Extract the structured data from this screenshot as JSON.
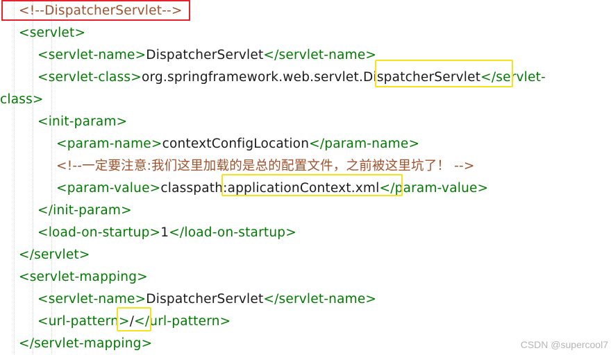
{
  "lines": [
    {
      "indent": 1,
      "parts": [
        {
          "c": "cmt",
          "t": "<!--DispatcherServlet-->"
        }
      ]
    },
    {
      "indent": 1,
      "parts": [
        {
          "c": "tag",
          "t": "<servlet>"
        }
      ]
    },
    {
      "indent": 2,
      "parts": [
        {
          "c": "tag",
          "t": "<servlet-name>"
        },
        {
          "c": "txt",
          "t": "DispatcherServlet"
        },
        {
          "c": "tag",
          "t": "</servlet-name>"
        }
      ]
    },
    {
      "indent": 2,
      "parts": [
        {
          "c": "tag",
          "t": "<servlet-class>"
        },
        {
          "c": "txt",
          "t": "org.springframework.web.servlet.DispatcherServlet"
        },
        {
          "c": "tag",
          "t": "</servlet-"
        }
      ]
    },
    {
      "indent": 0,
      "parts": [
        {
          "c": "tag",
          "t": "class>"
        }
      ]
    },
    {
      "indent": 2,
      "parts": [
        {
          "c": "tag",
          "t": "<init-param>"
        }
      ]
    },
    {
      "indent": 3,
      "parts": [
        {
          "c": "tag",
          "t": "<param-name>"
        },
        {
          "c": "txt",
          "t": "contextConfigLocation"
        },
        {
          "c": "tag",
          "t": "</param-name>"
        }
      ]
    },
    {
      "indent": 3,
      "parts": [
        {
          "c": "cmt",
          "t": "<!--一定要注意:我们这里加载的是总的配置文件，之前被这里坑了！ -->"
        }
      ]
    },
    {
      "indent": 3,
      "parts": [
        {
          "c": "tag",
          "t": "<param-value>"
        },
        {
          "c": "txt",
          "t": "classpath:applicationContext.xml"
        },
        {
          "c": "tag",
          "t": "</param-value>"
        }
      ]
    },
    {
      "indent": 2,
      "parts": [
        {
          "c": "tag",
          "t": "</init-param>"
        }
      ]
    },
    {
      "indent": 2,
      "parts": [
        {
          "c": "tag",
          "t": "<load-on-startup>"
        },
        {
          "c": "txt",
          "t": "1"
        },
        {
          "c": "tag",
          "t": "</load-on-startup>"
        }
      ]
    },
    {
      "indent": 1,
      "parts": [
        {
          "c": "tag",
          "t": "</servlet>"
        }
      ]
    },
    {
      "indent": 1,
      "parts": [
        {
          "c": "tag",
          "t": "<servlet-mapping>"
        }
      ]
    },
    {
      "indent": 2,
      "parts": [
        {
          "c": "tag",
          "t": "<servlet-name>"
        },
        {
          "c": "txt",
          "t": "DispatcherServlet"
        },
        {
          "c": "tag",
          "t": "</servlet-name>"
        }
      ]
    },
    {
      "indent": 2,
      "parts": [
        {
          "c": "tag",
          "t": "<url-pattern>"
        },
        {
          "c": "txt",
          "t": "/"
        },
        {
          "c": "tag",
          "t": "</url-pattern>"
        }
      ]
    },
    {
      "indent": 1,
      "parts": [
        {
          "c": "tag",
          "t": "</servlet-mapping>"
        }
      ]
    }
  ],
  "watermark": "CSDN @supercool7"
}
